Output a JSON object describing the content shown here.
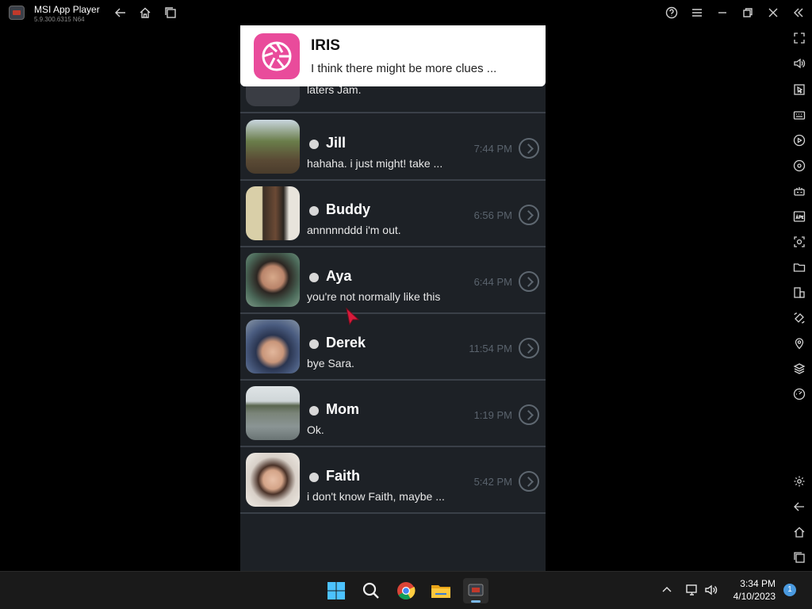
{
  "window": {
    "title": "MSI App Player",
    "version": "5.9.300.6315 N64"
  },
  "notification": {
    "app_name": "IRIS",
    "message": "I think there might be more clues ..."
  },
  "partial_row": {
    "preview": "laters Jam."
  },
  "contacts": [
    {
      "name": "Jill",
      "preview": "hahaha. i just might! take ...",
      "time": "7:44 PM"
    },
    {
      "name": "Buddy",
      "preview": "annnnnddd i'm out.",
      "time": "6:56 PM"
    },
    {
      "name": "Aya",
      "preview": "you're not normally like this",
      "time": "6:44 PM"
    },
    {
      "name": "Derek",
      "preview": "bye Sara.",
      "time": "11:54 PM"
    },
    {
      "name": "Mom",
      "preview": "Ok.",
      "time": "1:19 PM"
    },
    {
      "name": "Faith",
      "preview": "i don't know Faith, maybe ...",
      "time": "5:42 PM"
    }
  ],
  "taskbar": {
    "time": "3:34 PM",
    "date": "4/10/2023",
    "notification_count": "1"
  },
  "icons": {
    "title_bar": [
      "back-icon",
      "home-icon",
      "recent-apps-icon",
      "help-icon",
      "menu-icon",
      "minimize-icon",
      "restore-icon",
      "close-icon",
      "collapse-sidebar-icon"
    ],
    "side_toolbar": [
      "fullscreen-icon",
      "volume-icon",
      "cursor-lock-icon",
      "keyboard-icon",
      "macro-icon",
      "sync-icon",
      "gamepad-icon",
      "apk-install-icon",
      "screenshot-icon",
      "folder-icon",
      "multi-instance-icon",
      "rotate-icon",
      "location-icon",
      "layers-icon",
      "speed-icon",
      "settings-icon",
      "back-icon",
      "home-icon",
      "recent-apps-icon"
    ],
    "taskbar": [
      "windows-start-icon",
      "search-icon",
      "chrome-icon",
      "file-explorer-icon",
      "msi-app-player-icon"
    ],
    "tray": [
      "chevron-up-icon",
      "network-icon",
      "volume-icon"
    ]
  },
  "colors": {
    "phone_bg": "#1d2126",
    "notification_accent": "#e94b9b",
    "status_dot": "#d8d8d8",
    "badge": "#4a9ae0"
  }
}
